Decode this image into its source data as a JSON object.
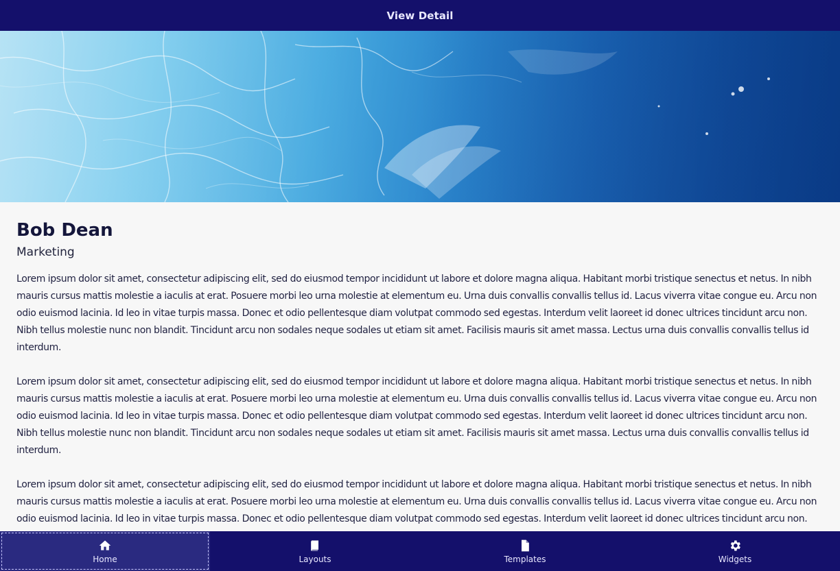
{
  "header": {
    "title": "View Detail"
  },
  "hero": {
    "image": "ocean-water-photo"
  },
  "profile": {
    "name": "Bob Dean",
    "department": "Marketing"
  },
  "paragraphs": [
    "Lorem ipsum dolor sit amet, consectetur adipiscing elit, sed do eiusmod tempor incididunt ut labore et dolore magna aliqua. Habitant morbi tristique senectus et netus. In nibh mauris cursus mattis molestie a iaculis at erat. Posuere morbi leo urna molestie at elementum eu. Urna duis convallis convallis tellus id. Lacus viverra vitae congue eu. Arcu non odio euismod lacinia. Id leo in vitae turpis massa. Donec et odio pellentesque diam volutpat commodo sed egestas. Interdum velit laoreet id donec ultrices tincidunt arcu non. Nibh tellus molestie nunc non blandit. Tincidunt arcu non sodales neque sodales ut etiam sit amet. Facilisis mauris sit amet massa. Lectus urna duis convallis convallis tellus id interdum.",
    "Lorem ipsum dolor sit amet, consectetur adipiscing elit, sed do eiusmod tempor incididunt ut labore et dolore magna aliqua. Habitant morbi tristique senectus et netus. In nibh mauris cursus mattis molestie a iaculis at erat. Posuere morbi leo urna molestie at elementum eu. Urna duis convallis convallis tellus id. Lacus viverra vitae congue eu. Arcu non odio euismod lacinia. Id leo in vitae turpis massa. Donec et odio pellentesque diam volutpat commodo sed egestas. Interdum velit laoreet id donec ultrices tincidunt arcu non. Nibh tellus molestie nunc non blandit. Tincidunt arcu non sodales neque sodales ut etiam sit amet. Facilisis mauris sit amet massa. Lectus urna duis convallis convallis tellus id interdum.",
    "Lorem ipsum dolor sit amet, consectetur adipiscing elit, sed do eiusmod tempor incididunt ut labore et dolore magna aliqua. Habitant morbi tristique senectus et netus. In nibh mauris cursus mattis molestie a iaculis at erat. Posuere morbi leo urna molestie at elementum eu. Urna duis convallis convallis tellus id. Lacus viverra vitae congue eu. Arcu non odio euismod lacinia. Id leo in vitae turpis massa. Donec et odio pellentesque diam volutpat commodo sed egestas. Interdum velit laoreet id donec ultrices tincidunt arcu non. Nibh tellus molestie nunc non blandit. Tincidunt arcu non sodales neque sodales ut etiam sit amet. Facilisis mauris sit amet massa. Lectus urna duis convallis convallis tellus id interdum."
  ],
  "bottom_nav": {
    "items": [
      {
        "label": "Home",
        "icon": "home-icon",
        "active": true
      },
      {
        "label": "Layouts",
        "icon": "book-icon",
        "active": false
      },
      {
        "label": "Templates",
        "icon": "file-icon",
        "active": false
      },
      {
        "label": "Widgets",
        "icon": "gear-icon",
        "active": false
      }
    ]
  },
  "colors": {
    "bar": "#14106b",
    "active_tab": "#2a2a80",
    "background": "#f7f7f7",
    "text": "#1a1a2e"
  }
}
